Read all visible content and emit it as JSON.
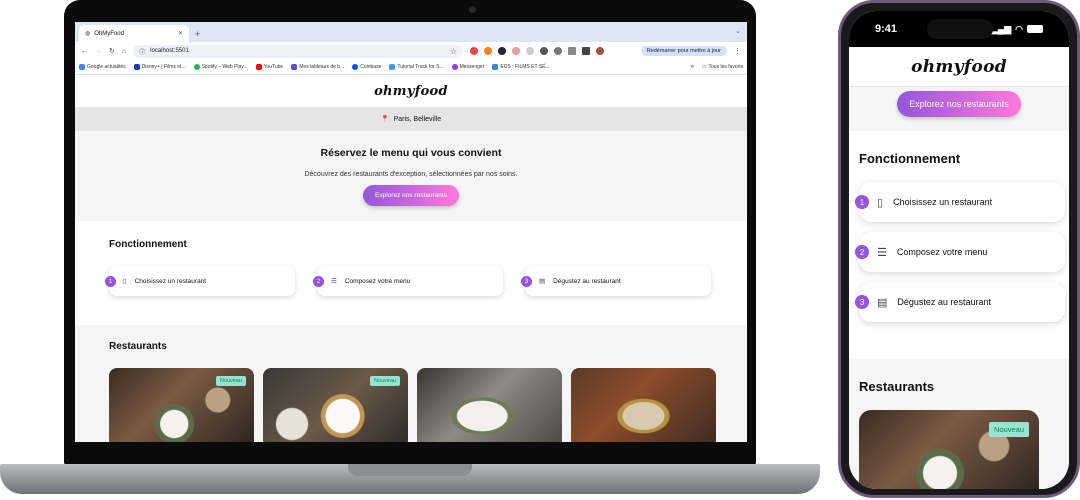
{
  "browser": {
    "tab_title": "OhMyFood",
    "tab_new": "+",
    "url": "localhost:5501",
    "relaunch_label": "Redémarrer pour mettre à jour",
    "bookmarks": [
      {
        "label": "Google actualités",
        "color": "#4285f4"
      },
      {
        "label": "Disney+ | Films et...",
        "color": "#113ccf"
      },
      {
        "label": "Spotify – Web Play...",
        "color": "#1db954"
      },
      {
        "label": "YouTube",
        "color": "#ff0000"
      },
      {
        "label": "Mes tableaux de b...",
        "color": "#5a4cdb"
      },
      {
        "label": "Coinbase",
        "color": "#0052ff"
      },
      {
        "label": "Tutorial Track for S...",
        "color": "#3b9bff"
      },
      {
        "label": "Messenger",
        "color": "#a033ff"
      },
      {
        "label": "EOS : FILMS ET SÉ...",
        "color": "#3b82f6"
      }
    ],
    "bookmarks_more": "»",
    "all_bookmarks": "Tous les favoris"
  },
  "site": {
    "logo": "ohmyfood",
    "location": "Paris, Belleville",
    "hero_title": "Réservez le menu qui vous convient",
    "hero_text": "Découvrez des restaurants d'exception, sélectionnées par nos soins.",
    "cta_label": "Explorez nos restaurants",
    "how_title": "Fonctionnement",
    "steps": [
      {
        "num": "1",
        "label": "Choisissez un restaurant",
        "icon": "phone-icon"
      },
      {
        "num": "2",
        "label": "Composez votre menu",
        "icon": "list-icon"
      },
      {
        "num": "3",
        "label": "Dégustez au restaurant",
        "icon": "store-icon"
      }
    ],
    "restaurants_title": "Restaurants",
    "new_badge": "Nouveau"
  },
  "phone": {
    "time": "9:41"
  },
  "colors": {
    "accent_start": "#9356dc",
    "accent_end": "#ff79da",
    "badge_bg": "#99e2d0",
    "badge_text": "#008766"
  }
}
